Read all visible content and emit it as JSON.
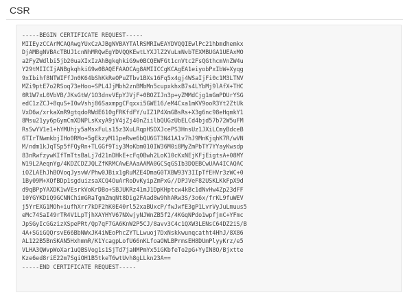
{
  "panel": {
    "title": "CSR"
  },
  "csr": {
    "text": "-----BEGIN CERTIFICATE REQUEST-----\nMIIEyzCCArMCAQAwgYUxCzAJBgNVBAYTAlRSMRIwEAYDVQQIEwlPc21hbmdhemkx\nDjAMBgNVBAcTBUJ1cnNhMRQwEgYDVQQKEwtLYXJlZ2VuLmNvbTEXMBUGA1UEAxMO\na2FyZWdlbi5jb20uaXIxIzAhBgkqhkiG9w0BCQEWFGt1cnVtc2FsQGthcmVnZW4u\nY29tMIICIjANBgkqhkiG9w0BAQEFAAOCAg8AMIICCgKCAgEA1eiyobPxIbW+Xyqg\n9xIbihf8NTWIFfJn0K64bShKkReOPuZTbv1BXs16Fq5x4gj4WSaIjFi0c1M3LTNV\nMZi9ptE7o2RSoq73eHoo+SPL4JjMbh2znBMbMn5cupxkhxB7s4LYbMj9lAfX+THC\n0R1W7xL0VbVB/JKsGtW/1O3dnvVEpYJVjF+0BOZIJn3p+yZMMdCjg1mGmPDUrYSG\nedC1zZCJ+8quS+I0wVshj86SaxmpgCFqxxi5GWE16/eM4Cxa1mKV9ooR3Yt2ZtUk\nVxD6w/xrkaXmR9gtqdoRWdE610gFRKfdFY/uIZ1P4XmGBsRs+X3g6nc98eHqmkY1\n8Msu21yy6pGymCmXDNPLsKxyA9jV4jZj40nZiilbQUGzUbELCd4bjd57b72W5uFM\nRsSwYV1e1+hYMUhjy5aMsxFuLs15z3XuLRqpHSDXJcePS3HnsUz1JXiLCmyBdceB\n6TIrTNwmkbjIHo0RMo+5gEkzyM11peRwe6bQU6GT3N41A1v7hJ9MnKjqhK7R/wVN\nM/ndm1kJqTSp5fFQyRn+TLGGf9Tiy3MoKbm010IW36M0i8MyZmPbTY7YYayKwsdp\n83nRwfzywKIfTmTtsBaLj7d21nDHkE+cFq0Bwh2LoK10cKxNEjKFjEigtsA+08MY\nW19L2AeqnYg/4KDZCDZJQLZfKRMCAwEAAaAAMA0GCSqGSIb3DQEBCwUAA4ICAQAC\niOZLAEhJhBOVoqJysvW/Phw0JBix1gRuMZE4DmaG0TXBW93Y3IIpTfEHVr3zWC+0\n1By09M+XQfBDp1sgduizsaXCQ4OuArRoDvKyipZmPxG//DPJVeF82USKLKkFpX9d\nd9qBPpYAXDK1wVEsrkVoKrDBo+SBJUKRz41mJ1DpKHptcw4kBc1dNvHw4Zp23dFF\n10YGYKDiQ9GCNNChimGRaTgmZmqNt8Dig2FAad8w9hhARw3S/3o6x/frKL9fuWEV\nj5YrEXG1MOh+iufhXrr7kDF2hK0E40rl52xaBUxcP/fwJwfE3gP1LvrVyJuLmuus5\neMc74SaI49rTR4V1LpTjhXAYHYV67NXwjyNJWnZB5f2/4KGqNPdo1wpfjmC+YFmc\nJpSGyIcGGzizXSpePRt/Qp7qF7GA6KnW2P5CJ/8avv3C4c1QXW3LENsC64DZ2iS/B\n4A+SGiGQQrsvE66BbNWxJK4iWEoPhcZYTLLwuoj7DxNskkwunqcatht4HhJ/8X86\nAL122B5BnSKAN5HxhmmR/K1YcagpLofU66nKLfoaOWLBPrmsEH8DUmPlyyKrz/e5\nVLHA3QWvpWoXar1uQBSVog1s1SjTd7jaNMPmYx5iGKbfeTo2pG+YyIN8O/Bjxtte\nKze6ed8riE22m7SgiOH1B5tkeT6wtUvh8gLLkn23A==\n-----END CERTIFICATE REQUEST-----"
  }
}
